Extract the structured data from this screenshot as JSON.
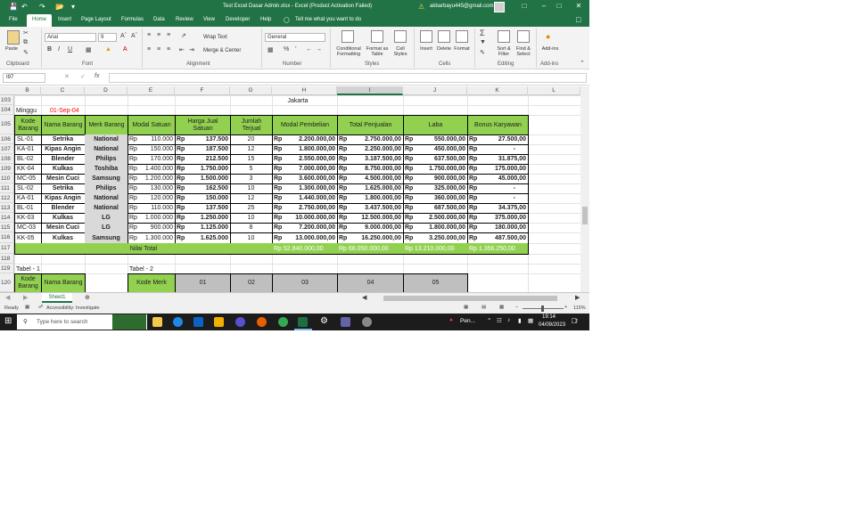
{
  "titlebar": {
    "title": "Test Excel Dasar Admin.xlsx  -  Excel (Product Activation Failed)",
    "account": "akbarbayu445@gmail.com"
  },
  "menu": [
    "File",
    "Home",
    "Insert",
    "Page Layout",
    "Formulas",
    "Data",
    "Review",
    "View",
    "Developer",
    "Help",
    "Tell me what you want to do"
  ],
  "ribbon": {
    "paste": "Paste",
    "font_name": "Arial",
    "font_size": "9",
    "wrap_text": "Wrap Text",
    "merge_center": "Merge & Center",
    "number_format": "General",
    "conditional_formatting": "Conditional Formatting",
    "format_as_table": "Format as Table",
    "cell_styles": "Cell Styles",
    "insert": "Insert",
    "delete": "Delete",
    "format": "Format",
    "sort_filter": "Sort & Filter",
    "find_select": "Find & Select",
    "addins": "Add-ins",
    "groups": {
      "clipboard": "Clipboard",
      "font": "Font",
      "alignment": "Alignment",
      "number": "Number",
      "styles": "Styles",
      "cells": "Cells",
      "editing": "Editing",
      "addins": "Add-ins"
    }
  },
  "formula_bar": {
    "name_box": "I97",
    "fx": "fx",
    "value": ""
  },
  "columns": [
    "B",
    "C",
    "D",
    "E",
    "F",
    "G",
    "H",
    "I",
    "J",
    "K",
    "L"
  ],
  "row_numbers": [
    "103",
    "104",
    "105",
    "106",
    "107",
    "108",
    "109",
    "110",
    "111",
    "112",
    "113",
    "114",
    "115",
    "116",
    "117",
    "118",
    "119",
    "120"
  ],
  "sheet": {
    "city": "Jakarta",
    "day": "Minggu",
    "date": "01-Sep-04",
    "headers": [
      "Kode Barang",
      "Nama Barang",
      "Merk Barang",
      "Modal Satuan",
      "Harga Jual Satuan",
      "Jumlah Terjual",
      "Modal Pembelian",
      "Total Penjualan",
      "Laba",
      "Bonus Karyawan"
    ],
    "currency": "Rp",
    "rows": [
      {
        "kode": "SL-01",
        "nama": "Setrika",
        "merk": "National",
        "modal": "110.000",
        "harga": "137.500",
        "jumlah": "20",
        "pembelian": "2.200.000,00",
        "penjualan": "2.750.000,00",
        "laba": "550.000,00",
        "bonus": "27.500,00"
      },
      {
        "kode": "KA-01",
        "nama": "Kipas Angin",
        "merk": "National",
        "modal": "150.000",
        "harga": "187.500",
        "jumlah": "12",
        "pembelian": "1.800.000,00",
        "penjualan": "2.250.000,00",
        "laba": "450.000,00",
        "bonus": "-"
      },
      {
        "kode": "BL-02",
        "nama": "Blender",
        "merk": "Philips",
        "modal": "170.000",
        "harga": "212.500",
        "jumlah": "15",
        "pembelian": "2.550.000,00",
        "penjualan": "3.187.500,00",
        "laba": "637.500,00",
        "bonus": "31.875,00"
      },
      {
        "kode": "KK-04",
        "nama": "Kulkas",
        "merk": "Toshiba",
        "modal": "1.400.000",
        "harga": "1.750.000",
        "jumlah": "5",
        "pembelian": "7.000.000,00",
        "penjualan": "8.750.000,00",
        "laba": "1.750.000,00",
        "bonus": "175.000,00"
      },
      {
        "kode": "MC-05",
        "nama": "Mesin Cuci",
        "merk": "Samsung",
        "modal": "1.200.000",
        "harga": "1.500.000",
        "jumlah": "3",
        "pembelian": "3.600.000,00",
        "penjualan": "4.500.000,00",
        "laba": "900.000,00",
        "bonus": "45.000,00"
      },
      {
        "kode": "SL-02",
        "nama": "Setrika",
        "merk": "Philips",
        "modal": "130.000",
        "harga": "162.500",
        "jumlah": "10",
        "pembelian": "1.300.000,00",
        "penjualan": "1.625.000,00",
        "laba": "325.000,00",
        "bonus": "-"
      },
      {
        "kode": "KA-01",
        "nama": "Kipas Angin",
        "merk": "National",
        "modal": "120.000",
        "harga": "150.000",
        "jumlah": "12",
        "pembelian": "1.440.000,00",
        "penjualan": "1.800.000,00",
        "laba": "360.000,00",
        "bonus": "-"
      },
      {
        "kode": "BL-01",
        "nama": "Blender",
        "merk": "National",
        "modal": "110.000",
        "harga": "137.500",
        "jumlah": "25",
        "pembelian": "2.750.000,00",
        "penjualan": "3.437.500,00",
        "laba": "687.500,00",
        "bonus": "34.375,00"
      },
      {
        "kode": "KK-03",
        "nama": "Kulkas",
        "merk": "LG",
        "modal": "1.000.000",
        "harga": "1.250.000",
        "jumlah": "10",
        "pembelian": "10.000.000,00",
        "penjualan": "12.500.000,00",
        "laba": "2.500.000,00",
        "bonus": "375.000,00"
      },
      {
        "kode": "MC-03",
        "nama": "Mesin Cuci",
        "merk": "LG",
        "modal": "900.000",
        "harga": "1.125.000",
        "jumlah": "8",
        "pembelian": "7.200.000,00",
        "penjualan": "9.000.000,00",
        "laba": "1.800.000,00",
        "bonus": "180.000,00"
      },
      {
        "kode": "KK-05",
        "nama": "Kulkas",
        "merk": "Samsung",
        "modal": "1.300.000",
        "harga": "1.625.000",
        "jumlah": "10",
        "pembelian": "13.000.000,00",
        "penjualan": "16.250.000,00",
        "laba": "3.250.000,00",
        "bonus": "487.500,00"
      }
    ],
    "total": {
      "label": "Nilai Total",
      "pembelian": "Rp 52.840.000,00",
      "penjualan": "Rp 66.050.000,00",
      "laba": "Rp 13.210.000,00",
      "bonus": "Rp 1.356.250,00"
    },
    "tabel1": "Tabel - 1",
    "tabel2": "Tabel - 2",
    "t1_headers": [
      "Kode Barang",
      "Nama Barang"
    ],
    "t2_headers": [
      "Kode Merk",
      "01",
      "02",
      "03",
      "04",
      "05"
    ]
  },
  "sheet_tab": "Sheet1",
  "status": {
    "ready": "Ready",
    "accessibility": "Accessibility: Investigate",
    "zoom": "115%"
  },
  "taskbar": {
    "search": "Type here to search",
    "weather": "Pen...",
    "time": "19:14",
    "date": "04/09/2023",
    "notif": "2"
  }
}
